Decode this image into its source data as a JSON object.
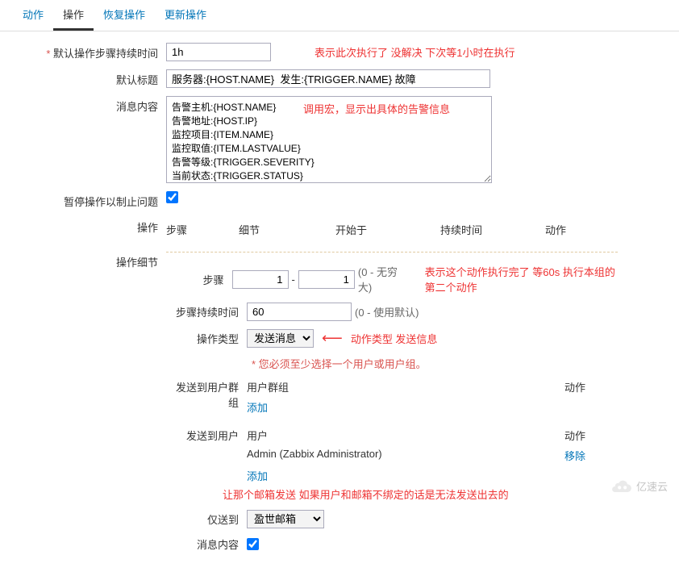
{
  "tabs": [
    "动作",
    "操作",
    "恢复操作",
    "更新操作"
  ],
  "active_tab": 1,
  "form": {
    "default_step_duration_label": "默认操作步骤持续时间",
    "default_step_duration_value": "1h",
    "default_subject_label": "默认标题",
    "default_subject_value": "服务器:{HOST.NAME}  发生:{TRIGGER.NAME} 故障",
    "message_label": "消息内容",
    "message_value": "告警主机:{HOST.NAME}\n告警地址:{HOST.IP}\n监控项目:{ITEM.NAME}\n监控取值:{ITEM.LASTVALUE}\n告警等级:{TRIGGER.SEVERITY}\n当前状态:{TRIGGER.STATUS}\n告警信息:{TRIGGER.NAME}",
    "pause_label": "暂停操作以制止问题",
    "pause_checked": true,
    "ops_label": "操作",
    "ops_headers": [
      "步骤",
      "细节",
      "开始于",
      "持续时间",
      "动作"
    ],
    "ops_detail_label": "操作细节",
    "steps_label": "步骤",
    "step_from": "1",
    "step_to": "1",
    "step_hint": "(0 - 无穷大)",
    "step_duration_label": "步骤持续时间",
    "step_duration_value": "60",
    "step_duration_hint": "(0 - 使用默认)",
    "op_type_label": "操作类型",
    "op_type_value": "发送消息",
    "must_select": "您必须至少选择一个用户或用户组。",
    "send_group_label": "发送到用户群组",
    "group_col": "用户群组",
    "action_col": "动作",
    "add_text": "添加",
    "send_user_label": "发送到用户",
    "user_col": "用户",
    "user_row": "Admin (Zabbix Administrator)",
    "remove_text": "移除",
    "only_to_label": "仅送到",
    "only_to_value": "盈世邮箱",
    "msg_content_label": "消息内容",
    "msg_content_checked": true
  },
  "annotations": {
    "a1": "表示此次执行了 没解决 下次等1小时在执行",
    "a2": "调用宏，显示出具体的告警信息",
    "a3": "表示这个动作执行完了 等60s 执行本组的第二个动作",
    "a4": "动作类型 发送信息",
    "a5": "让那个邮箱发送 如果用户和邮箱不绑定的话是无法发送出去的"
  },
  "watermark": "亿速云"
}
